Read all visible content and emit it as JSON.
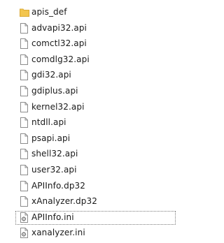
{
  "files": [
    {
      "name": "apis_def",
      "icon": "folder-icon",
      "selected": false
    },
    {
      "name": "advapi32.api",
      "icon": "file-icon",
      "selected": false
    },
    {
      "name": "comctl32.api",
      "icon": "file-icon",
      "selected": false
    },
    {
      "name": "comdlg32.api",
      "icon": "file-icon",
      "selected": false
    },
    {
      "name": "gdi32.api",
      "icon": "file-icon",
      "selected": false
    },
    {
      "name": "gdiplus.api",
      "icon": "file-icon",
      "selected": false
    },
    {
      "name": "kernel32.api",
      "icon": "file-icon",
      "selected": false
    },
    {
      "name": "ntdll.api",
      "icon": "file-icon",
      "selected": false
    },
    {
      "name": "psapi.api",
      "icon": "file-icon",
      "selected": false
    },
    {
      "name": "shell32.api",
      "icon": "file-icon",
      "selected": false
    },
    {
      "name": "user32.api",
      "icon": "file-icon",
      "selected": false
    },
    {
      "name": "APIInfo.dp32",
      "icon": "file-icon",
      "selected": false
    },
    {
      "name": "xAnalyzer.dp32",
      "icon": "file-icon",
      "selected": false
    },
    {
      "name": "APIInfo.ini",
      "icon": "settings-file-icon",
      "selected": true
    },
    {
      "name": "xanalyzer.ini",
      "icon": "settings-file-icon",
      "selected": false
    }
  ],
  "colors": {
    "folder": "#f3c64f",
    "folder_dark": "#dba932",
    "file_outline": "#8c8c8c",
    "selection_border": "#7a7a7a"
  }
}
